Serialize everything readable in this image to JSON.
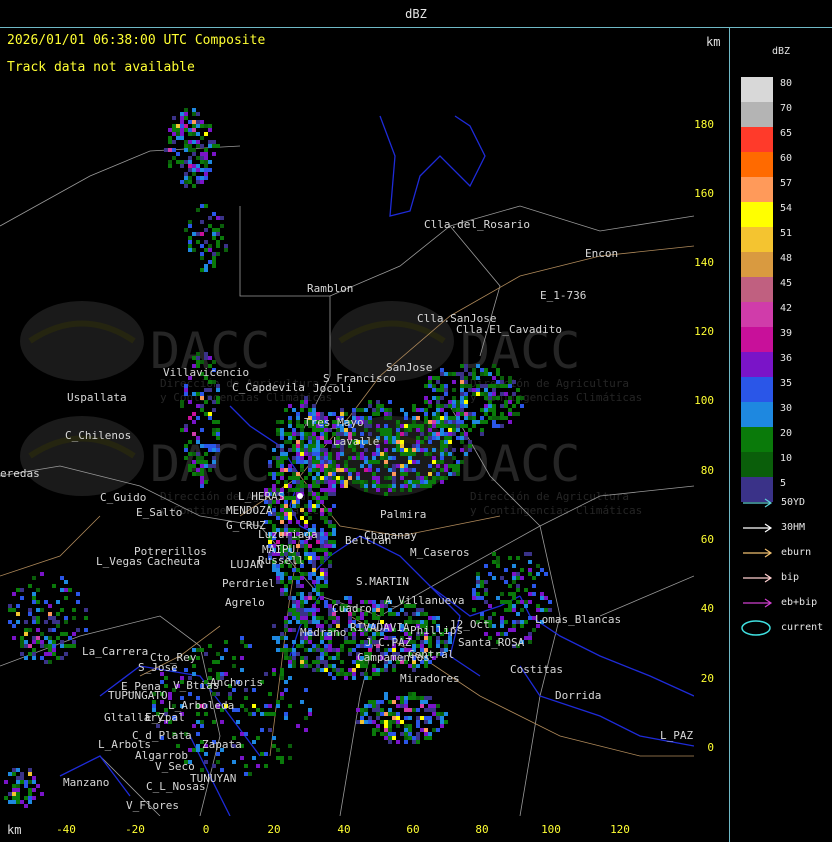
{
  "window": {
    "title": "dBZ"
  },
  "header": {
    "timestamp": "2026/01/01 06:38:00 UTC Composite",
    "track_status": "Track data not available",
    "km_unit_top": "km",
    "km_unit_bottom": "km"
  },
  "y_axis": {
    "ticks": [
      "180",
      "160",
      "140",
      "120",
      "100",
      "80",
      "60",
      "40",
      "20",
      "0"
    ]
  },
  "x_axis": {
    "ticks": [
      "-40",
      "-20",
      "0",
      "20",
      "40",
      "60",
      "80",
      "100",
      "120"
    ]
  },
  "legend": {
    "unit": "dBZ",
    "levels": [
      {
        "value": "80",
        "color": "#d8d8d8"
      },
      {
        "value": "70",
        "color": "#b4b4b4"
      },
      {
        "value": "65",
        "color": "#ff3a2a"
      },
      {
        "value": "60",
        "color": "#ff6a00"
      },
      {
        "value": "57",
        "color": "#ff9a5a"
      },
      {
        "value": "54",
        "color": "#ffff00"
      },
      {
        "value": "51",
        "color": "#f4c430"
      },
      {
        "value": "48",
        "color": "#d99a40"
      },
      {
        "value": "45",
        "color": "#c06080"
      },
      {
        "value": "42",
        "color": "#d03caa"
      },
      {
        "value": "39",
        "color": "#c8109a"
      },
      {
        "value": "36",
        "color": "#7a14c8"
      },
      {
        "value": "35",
        "color": "#2a56e8"
      },
      {
        "value": "30",
        "color": "#1e88e0"
      },
      {
        "value": "20",
        "color": "#0a7a0a"
      },
      {
        "value": "10",
        "color": "#0a5e0a"
      },
      {
        "value": "5",
        "color": "#3a3288"
      }
    ]
  },
  "track_keys": [
    {
      "label": "50YD",
      "color": "#5fd0d8"
    },
    {
      "label": "30HM",
      "color": "#ffffff"
    },
    {
      "label": "eburn",
      "color": "#f0c070"
    },
    {
      "label": "bip",
      "color": "#ffd0d0"
    },
    {
      "label": "eb+bip",
      "color": "#d040d0"
    },
    {
      "label": "current",
      "color": "#40e0e0"
    }
  ],
  "watermark": {
    "brand": "DACC",
    "line1": "Dirección de Agricultura",
    "line2": "y Contingencias Climáticas"
  },
  "places": [
    {
      "name": "Clla.del_Rosario"
    },
    {
      "name": "Encon"
    },
    {
      "name": "E_1-736"
    },
    {
      "name": "Ramblon"
    },
    {
      "name": "Clla.SanJose"
    },
    {
      "name": "Clla.El_Cavadito"
    },
    {
      "name": "Villavicencio"
    },
    {
      "name": "C_Capdevila"
    },
    {
      "name": "S_Francisco"
    },
    {
      "name": "SanJose"
    },
    {
      "name": "Jocoli"
    },
    {
      "name": "Uspallata"
    },
    {
      "name": "C_Chilenos"
    },
    {
      "name": "Tres_Mayo"
    },
    {
      "name": "Lavalle"
    },
    {
      "name": "L_HERAS"
    },
    {
      "name": "MENDOZA"
    },
    {
      "name": "G_CRUZ"
    },
    {
      "name": "Luzuriaga"
    },
    {
      "name": "MAIPU"
    },
    {
      "name": "Russell"
    },
    {
      "name": "LUJAN"
    },
    {
      "name": "Perdriel"
    },
    {
      "name": "Agrelo"
    },
    {
      "name": "Potrerillos"
    },
    {
      "name": "L_Vegas"
    },
    {
      "name": "Cacheuta"
    },
    {
      "name": "C_Guido"
    },
    {
      "name": "E_Salto"
    },
    {
      "name": "Chapanay"
    },
    {
      "name": "M_Caseros"
    },
    {
      "name": "Beltran"
    },
    {
      "name": "S.MARTIN"
    },
    {
      "name": "A_Villanueva"
    },
    {
      "name": "RIVADAVIA"
    },
    {
      "name": "Phillips"
    },
    {
      "name": "12_Oct"
    },
    {
      "name": "Lomas_Blancas"
    },
    {
      "name": "J.C.PAZ"
    },
    {
      "name": "Santa_ROSA"
    },
    {
      "name": "Costitas"
    },
    {
      "name": "Dorrida"
    },
    {
      "name": "Miradores"
    },
    {
      "name": "Campamentos"
    },
    {
      "name": "Central"
    },
    {
      "name": "La_Carrera"
    },
    {
      "name": "Cto_Rey"
    },
    {
      "name": "S_Jose"
    },
    {
      "name": "E_Pena"
    },
    {
      "name": "TUPUNGATO"
    },
    {
      "name": "V_Btias"
    },
    {
      "name": "Anchoris"
    },
    {
      "name": "L_Arboleda"
    },
    {
      "name": "Gltallary"
    },
    {
      "name": "E_Zpal"
    },
    {
      "name": "C_d_Plata"
    },
    {
      "name": "L_Arbols"
    },
    {
      "name": "Zapata"
    },
    {
      "name": "Algarrob"
    },
    {
      "name": "V_Seco"
    },
    {
      "name": "Manzano"
    },
    {
      "name": "C_L_Nosas"
    },
    {
      "name": "TUNUYAN"
    },
    {
      "name": "V_Flores"
    },
    {
      "name": "L_PAZ"
    },
    {
      "name": "eredas"
    },
    {
      "name": "Palmira"
    },
    {
      "name": "Medrano"
    },
    {
      "name": "Cuadro"
    }
  ],
  "colors": {
    "frame": "#6fb9c6",
    "tick_text": "#ffff33",
    "border_blue": "#1e2bd8",
    "road": "#b08a5a",
    "dept_line": "#9a9a9a"
  }
}
